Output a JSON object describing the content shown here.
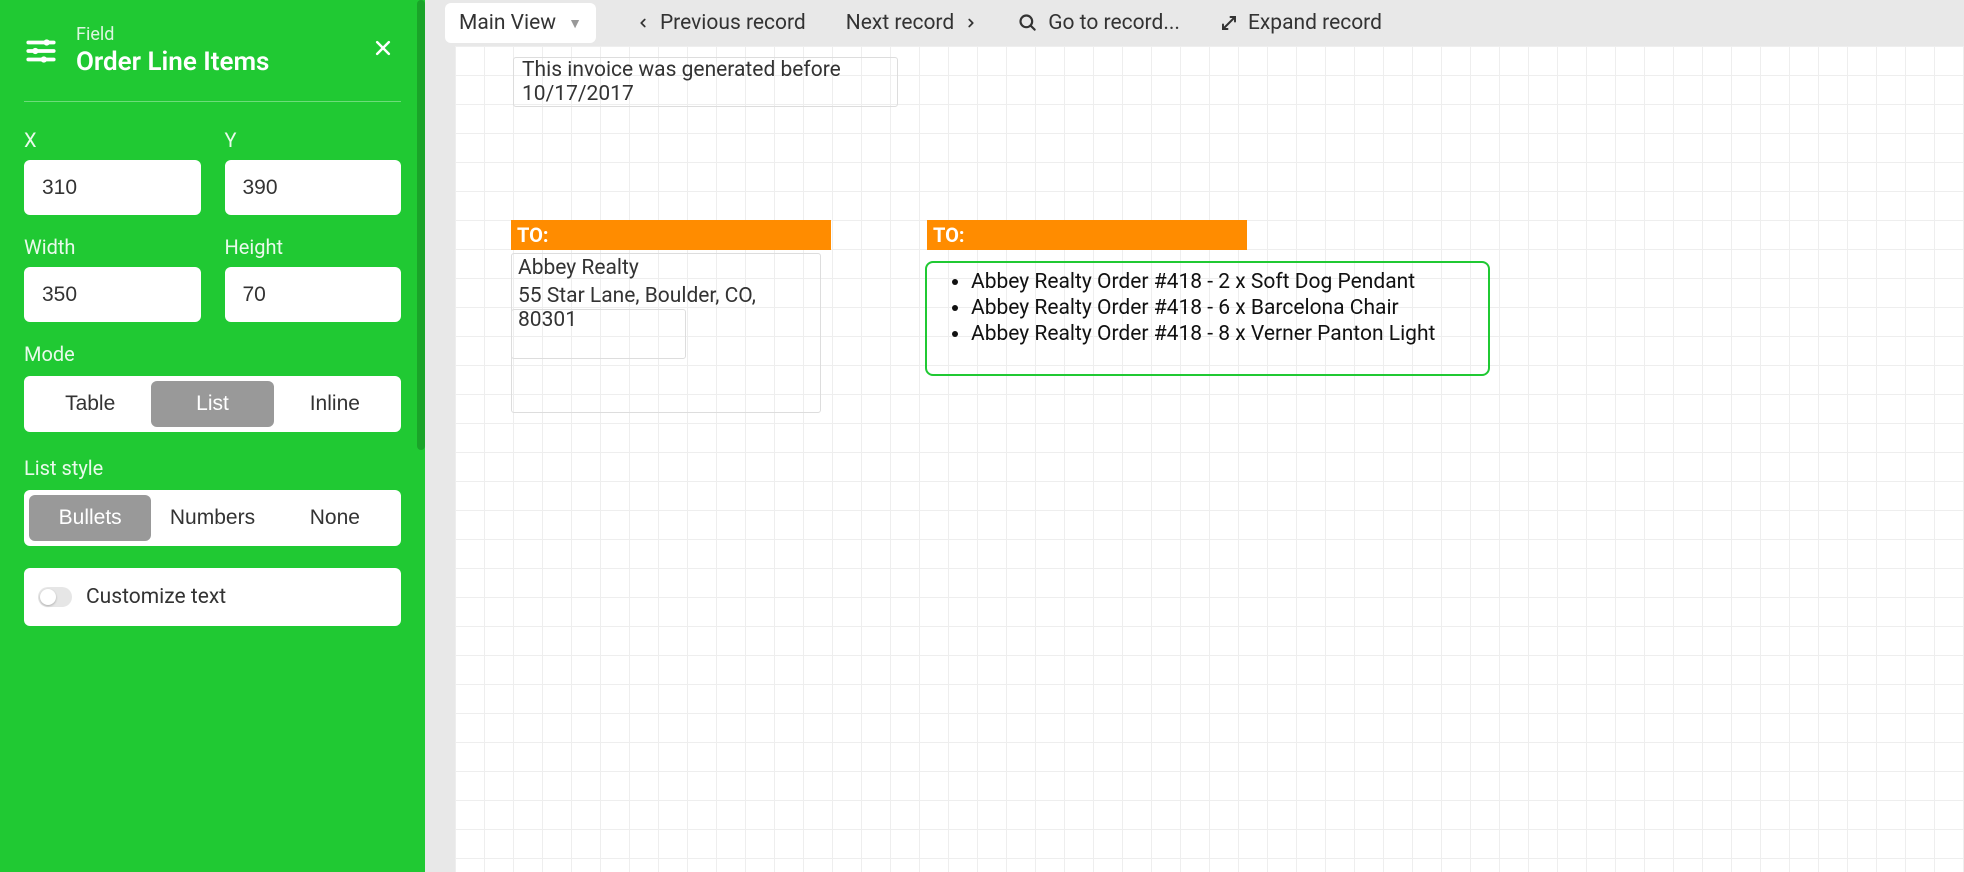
{
  "sidebar": {
    "eyebrow": "Field",
    "title": "Order Line Items",
    "x_label": "X",
    "y_label": "Y",
    "x_value": "310",
    "y_value": "390",
    "width_label": "Width",
    "height_label": "Height",
    "width_value": "350",
    "height_value": "70",
    "mode_label": "Mode",
    "mode_options": {
      "table": "Table",
      "list": "List",
      "inline": "Inline"
    },
    "list_style_label": "List style",
    "list_style_options": {
      "bullets": "Bullets",
      "numbers": "Numbers",
      "none": "None"
    },
    "customize_text_label": "Customize text"
  },
  "toolbar": {
    "view_label": "Main View",
    "previous": "Previous record",
    "next": "Next record",
    "goto": "Go to record...",
    "expand": "Expand record"
  },
  "canvas": {
    "notice": "This invoice was generated before 10/17/2017",
    "to_label_left": "TO:",
    "to_label_right": "TO:",
    "address": {
      "name": "Abbey Realty",
      "line": "55 Star Lane, Boulder, CO, 80301"
    },
    "line_items": [
      "Abbey Realty Order #418 - 2 x Soft Dog Pendant",
      "Abbey Realty Order #418 - 6 x Barcelona Chair",
      "Abbey Realty Order #418 - 8 x Verner Panton Light"
    ]
  }
}
